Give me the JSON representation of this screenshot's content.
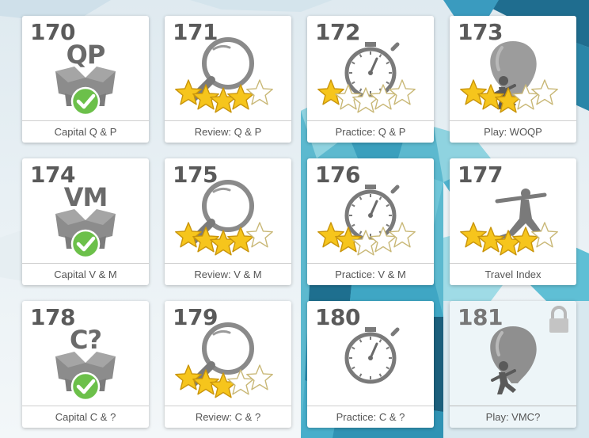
{
  "colors": {
    "card_bg": "#ffffff",
    "number": "#5a5a5a",
    "icon_gray": "#8a8a8a",
    "star_fill": "#f6c51c",
    "check_green": "#6cc04a"
  },
  "cards": [
    {
      "number": "170",
      "label": "Capital Q & P",
      "kind": "box",
      "box_text": "QP",
      "stars": null,
      "icon": "box-check-icon"
    },
    {
      "number": "171",
      "label": "Review: Q & P",
      "kind": "review",
      "stars": 4,
      "icon": "magnifier-icon"
    },
    {
      "number": "172",
      "label": "Practice: Q & P",
      "kind": "practice",
      "stars": 1,
      "icon": "stopwatch-icon"
    },
    {
      "number": "173",
      "label": "Play: WOQP",
      "kind": "play",
      "stars": 3,
      "icon": "balloon-runner-icon"
    },
    {
      "number": "174",
      "label": "Capital V & M",
      "kind": "box",
      "box_text": "VM",
      "stars": null,
      "icon": "box-check-icon"
    },
    {
      "number": "175",
      "label": "Review: V & M",
      "kind": "review",
      "stars": 4,
      "icon": "magnifier-icon"
    },
    {
      "number": "176",
      "label": "Practice: V & M",
      "kind": "practice",
      "stars": 2,
      "icon": "stopwatch-icon"
    },
    {
      "number": "177",
      "label": "Travel Index",
      "kind": "travel",
      "stars": 4,
      "icon": "yoga-figure-icon"
    },
    {
      "number": "178",
      "label": "Capital C & ?",
      "kind": "box",
      "box_text": "C?",
      "stars": null,
      "icon": "box-check-icon"
    },
    {
      "number": "179",
      "label": "Review: C & ?",
      "kind": "review",
      "stars": 3,
      "icon": "magnifier-icon"
    },
    {
      "number": "180",
      "label": "Practice: C & ?",
      "kind": "practice",
      "stars": 0,
      "icon": "stopwatch-icon"
    },
    {
      "number": "181",
      "label": "Play: VMC?",
      "kind": "play",
      "stars": 0,
      "locked": true,
      "icon": "balloon-runner-icon"
    }
  ]
}
